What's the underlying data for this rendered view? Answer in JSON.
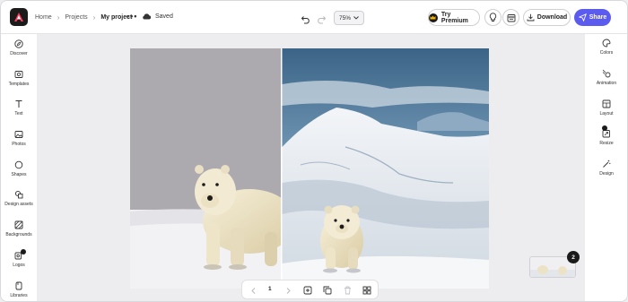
{
  "header": {
    "breadcrumbs": [
      "Home",
      "Projects"
    ],
    "current_project": "My project",
    "more_label": "•••",
    "save_status": "Saved",
    "zoom": "75%",
    "premium_label": "Try Premium",
    "download_label": "Download",
    "share_label": "Share"
  },
  "left_sidebar": {
    "items": [
      {
        "label": "Discover",
        "icon": "compass-icon"
      },
      {
        "label": "Templates",
        "icon": "templates-icon"
      },
      {
        "label": "Text",
        "icon": "text-icon"
      },
      {
        "label": "Photos",
        "icon": "photo-icon"
      },
      {
        "label": "Shapes",
        "icon": "shapes-icon"
      },
      {
        "label": "Design assets",
        "icon": "design-assets-icon"
      },
      {
        "label": "Backgrounds",
        "icon": "backgrounds-icon"
      },
      {
        "label": "Logos",
        "icon": "logos-icon"
      },
      {
        "label": "Libraries",
        "icon": "libraries-icon"
      }
    ]
  },
  "right_sidebar": {
    "items": [
      {
        "label": "Colors",
        "icon": "palette-icon"
      },
      {
        "label": "Animation",
        "icon": "animation-icon"
      },
      {
        "label": "Layout",
        "icon": "layout-icon"
      },
      {
        "label": "Resize",
        "icon": "resize-icon"
      },
      {
        "label": "Design",
        "icon": "magic-wand-icon"
      }
    ]
  },
  "canvas": {
    "page_number": "1",
    "page_count": "2"
  },
  "colors": {
    "accent": "#5b5bf0",
    "rail_bg": "#ffffff",
    "workspace_bg": "#ededf0"
  }
}
